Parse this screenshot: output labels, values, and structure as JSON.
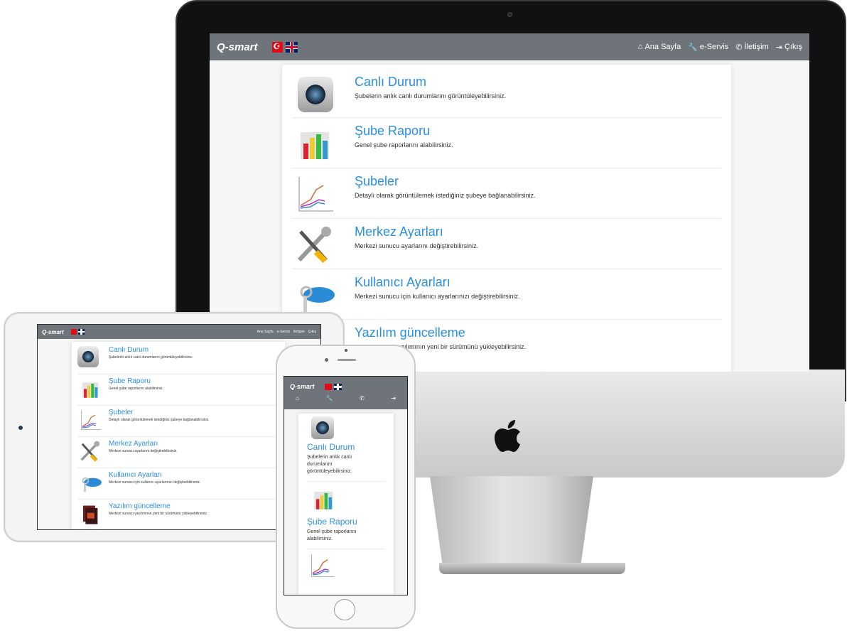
{
  "brand": "Q-smart",
  "nav": {
    "home": "Ana Sayfa",
    "service": "e-Servis",
    "contact": "İletişim",
    "logout": "Çıkış"
  },
  "items": [
    {
      "title": "Canlı Durum",
      "desc": "Şubelerin anlık canlı durumlarını görüntüleyebilirsiniz.",
      "icon": "camera-icon"
    },
    {
      "title": "Şube Raporu",
      "desc": "Genel şube raporlarını alabilirsiniz.",
      "icon": "bar-chart-icon"
    },
    {
      "title": "Şubeler",
      "desc": "Detaylı olarak görüntülemek istediğiniz şubeye bağlanabilirsiniz.",
      "icon": "line-chart-icon"
    },
    {
      "title": "Merkez Ayarları",
      "desc": "Merkezi sunucu ayarlarını değiştirebilirsiniz.",
      "icon": "tools-icon"
    },
    {
      "title": "Kullanıcı Ayarları",
      "desc": "Merkezi sunucu için kullanıcı ayarlarınızı değiştirebilirsiniz.",
      "icon": "keys-icon"
    },
    {
      "title": "Yazılım güncelleme",
      "desc": "Merkezi sunucu yazılımının yeni bir sürümünü yükleyebilirsiniz.",
      "icon": "software-box-icon"
    }
  ],
  "imac_last_desc": "cu yazılımının yeni bir sürümünü yükleyebilirsiniz.",
  "phone": {
    "desc0_lines": [
      "Şubelerin anlık canlı",
      "durumlarını",
      "görüntüleyebilirsiniz."
    ],
    "desc1_lines": [
      "Genel şube raporlarını",
      "alabilirsiniz."
    ]
  },
  "colors": {
    "navbar": "#6e7479",
    "link": "#2b8fe0"
  }
}
